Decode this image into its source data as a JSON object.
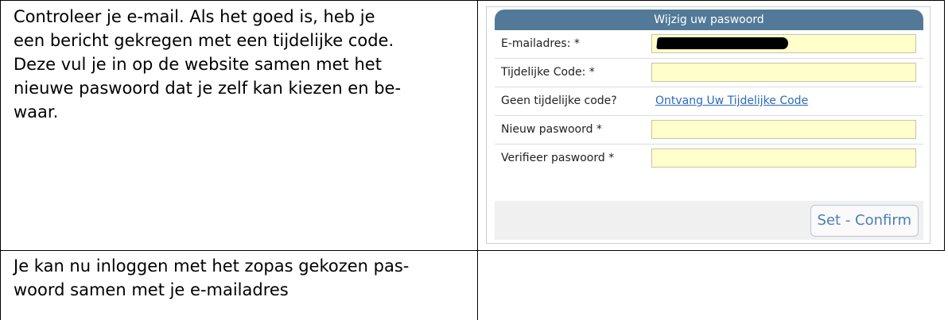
{
  "instructions": {
    "step1_lines": [
      "Controleer je e-mail. Als het goed is, heb je",
      "een bericht gekregen met een tijdelijke code.",
      "Deze vul je in op de website samen met het",
      "nieuwe paswoord dat je zelf kan kiezen en be-",
      "waar."
    ],
    "step2_lines": [
      "Je kan nu inloggen met het zopas gekozen pas-",
      "woord samen met je e-mailadres"
    ]
  },
  "form": {
    "title": "Wijzig uw paswoord",
    "email_label": "E-mailadres: *",
    "temp_code_label": "Tijdelijke Code: *",
    "no_code_label": "Geen tijdelijke code?",
    "receive_code_link": "Ontvang Uw Tijdelijke Code",
    "new_password_label": "Nieuw paswoord *",
    "verify_password_label": "Verifieer paswoord *",
    "submit_label": "Set - Confirm",
    "colors": {
      "header": "#527a98",
      "input_bg": "#ffffcc",
      "link": "#2a6ab8",
      "button_text": "#4a7fb8"
    }
  }
}
